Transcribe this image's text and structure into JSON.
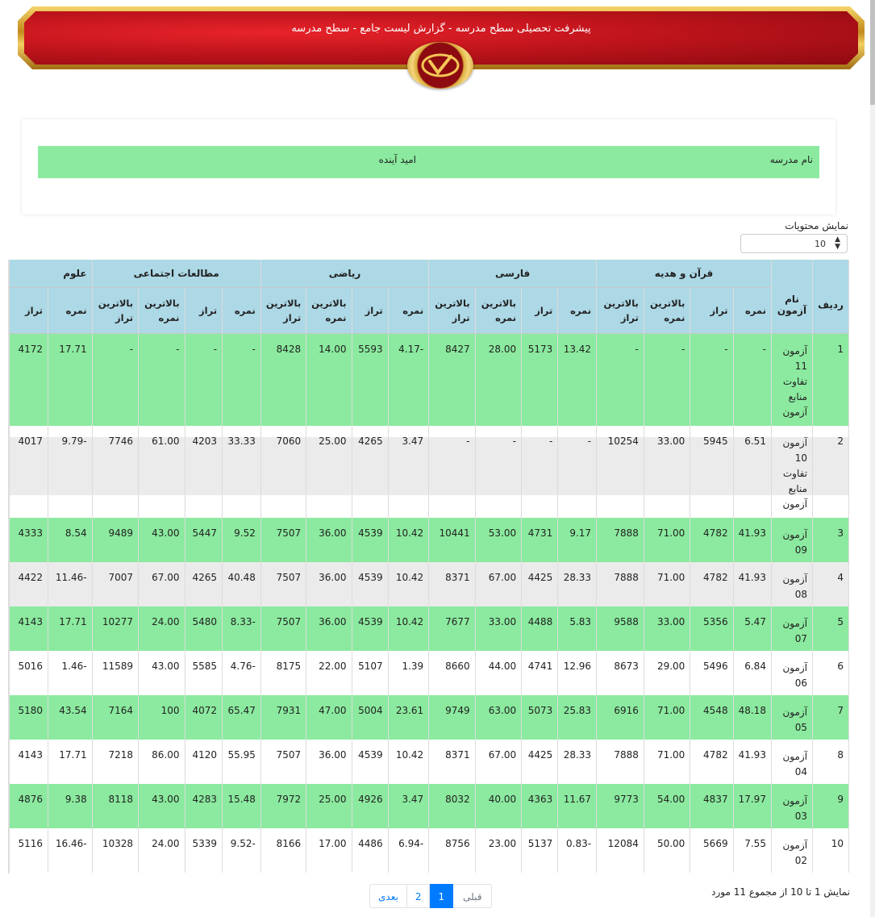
{
  "banner": {
    "title": "پیشرفت تحصیلی سطح مدرسه - گزارش لیست جامع - سطح مدرسه"
  },
  "school": {
    "label": "نام مدرسه",
    "value": "امید آینده"
  },
  "length": {
    "label": "نمایش محتویات",
    "value": "10"
  },
  "table": {
    "col_index": "ردیف",
    "col_name": "نام آزمون",
    "groups": [
      "قرآن و هدیه",
      "فارسی",
      "ریاضی",
      "مطالعات اجتماعی",
      "علوم"
    ],
    "sub": {
      "score": "نمره",
      "taraz": "تراز",
      "max_score": "بالاترین نمره",
      "max_taraz": "بالاترین تراز"
    },
    "rows": [
      {
        "idx": "1",
        "name": "آزمون 11 تفاوت منابع آزمون",
        "vals": [
          "-",
          "-",
          "-",
          "-",
          "13.42",
          "5173",
          "28.00",
          "8427",
          "-4.17",
          "5593",
          "14.00",
          "8428",
          "-",
          "-",
          "-",
          "-",
          "17.71",
          "4172"
        ]
      },
      {
        "idx": "2",
        "name": "آزمون 10 تفاوت منابع آزمون",
        "vals": [
          "6.51",
          "5945",
          "33.00",
          "10254",
          "-",
          "-",
          "-",
          "-",
          "3.47",
          "4265",
          "25.00",
          "7060",
          "33.33",
          "4203",
          "61.00",
          "7746",
          "-9.79",
          "4017"
        ]
      },
      {
        "idx": "3",
        "name": "آزمون 09",
        "vals": [
          "41.93",
          "4782",
          "71.00",
          "7888",
          "9.17",
          "4731",
          "53.00",
          "10441",
          "10.42",
          "4539",
          "36.00",
          "7507",
          "9.52",
          "5447",
          "43.00",
          "9489",
          "8.54",
          "4333"
        ]
      },
      {
        "idx": "4",
        "name": "آزمون 08",
        "vals": [
          "41.93",
          "4782",
          "71.00",
          "7888",
          "28.33",
          "4425",
          "67.00",
          "8371",
          "10.42",
          "4539",
          "36.00",
          "7507",
          "40.48",
          "4265",
          "67.00",
          "7007",
          "-11.46",
          "4422"
        ]
      },
      {
        "idx": "5",
        "name": "آزمون 07",
        "vals": [
          "5.47",
          "5356",
          "33.00",
          "9588",
          "5.83",
          "4488",
          "33.00",
          "7677",
          "10.42",
          "4539",
          "36.00",
          "7507",
          "-8.33",
          "5480",
          "24.00",
          "10277",
          "17.71",
          "4143"
        ]
      },
      {
        "idx": "6",
        "name": "آزمون 06",
        "vals": [
          "6.84",
          "5496",
          "29.00",
          "8673",
          "12.96",
          "4741",
          "44.00",
          "8660",
          "1.39",
          "5107",
          "22.00",
          "8175",
          "-4.76",
          "5585",
          "43.00",
          "11589",
          "-1.46",
          "5016"
        ]
      },
      {
        "idx": "7",
        "name": "آزمون 05",
        "vals": [
          "48.18",
          "4548",
          "71.00",
          "6916",
          "25.83",
          "5073",
          "63.00",
          "9749",
          "23.61",
          "5004",
          "47.00",
          "7931",
          "65.47",
          "4072",
          "100",
          "7164",
          "43.54",
          "5180"
        ]
      },
      {
        "idx": "8",
        "name": "آزمون 04",
        "vals": [
          "41.93",
          "4782",
          "71.00",
          "7888",
          "28.33",
          "4425",
          "67.00",
          "8371",
          "10.42",
          "4539",
          "36.00",
          "7507",
          "55.95",
          "4120",
          "86.00",
          "7218",
          "17.71",
          "4143"
        ]
      },
      {
        "idx": "9",
        "name": "آزمون 03",
        "vals": [
          "17.97",
          "4837",
          "54.00",
          "9773",
          "11.67",
          "4363",
          "40.00",
          "8032",
          "3.47",
          "4926",
          "25.00",
          "7972",
          "15.48",
          "4283",
          "43.00",
          "8118",
          "9.38",
          "4876"
        ]
      },
      {
        "idx": "10",
        "name": "آزمون 02",
        "vals": [
          "7.55",
          "5669",
          "50.00",
          "12084",
          "-0.83",
          "5137",
          "23.00",
          "8756",
          "-6.94",
          "4486",
          "17.00",
          "8166",
          "-9.52",
          "5339",
          "24.00",
          "10328",
          "-16.46",
          "5116"
        ]
      }
    ]
  },
  "footer": {
    "info": "نمایش 1 تا 10 از مجموع 11 مورد",
    "prev": "قبلی",
    "pages": [
      "1",
      "2"
    ],
    "next": "بعدی"
  }
}
